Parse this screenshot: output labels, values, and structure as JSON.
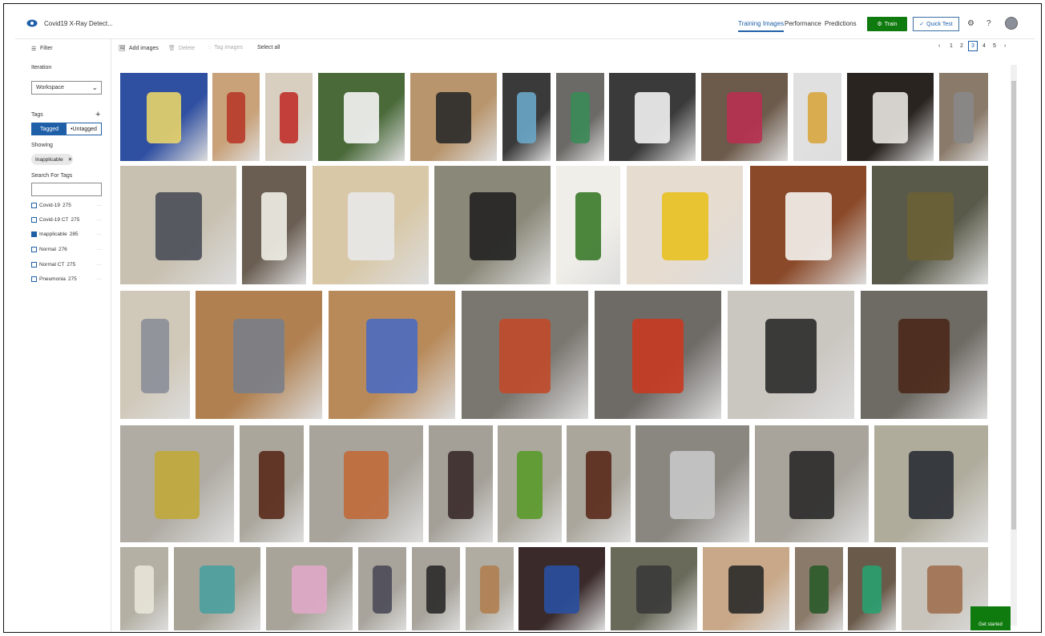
{
  "app": {
    "title": "Covid19 X-Ray Detect..."
  },
  "nav": {
    "training": "Training Images",
    "performance": "Performance",
    "predictions": "Predictions"
  },
  "buttons": {
    "train": "Train",
    "quick_test": "Quick Test"
  },
  "sidebar": {
    "filter": "Filter",
    "iteration_label": "Iteration",
    "iteration_value": "Workspace",
    "tags_label": "Tags",
    "tagged": "Tagged",
    "untagged": "Untagged",
    "showing": "Showing",
    "chip": "Inapplicable",
    "search_label": "Search For Tags",
    "tags": [
      {
        "name": "Covid-19",
        "count": "275",
        "checked": false
      },
      {
        "name": "Covid-19 CT",
        "count": "275",
        "checked": false
      },
      {
        "name": "Inapplicable",
        "count": "285",
        "checked": true
      },
      {
        "name": "Normal",
        "count": "276",
        "checked": false
      },
      {
        "name": "Normal CT",
        "count": "275",
        "checked": false
      },
      {
        "name": "Pneumonia",
        "count": "275",
        "checked": false
      }
    ]
  },
  "toolbar": {
    "add": "Add images",
    "delete": "Delete",
    "tag": "Tag images",
    "select_all": "Select all"
  },
  "pagination": {
    "pages": [
      "1",
      "2",
      "3",
      "4",
      "5"
    ],
    "current": "3"
  },
  "footer": {
    "get_started": "Get started"
  },
  "icons": [
    "eye-icon",
    "filter-icon",
    "add-icon",
    "chevron-down-icon",
    "close-icon",
    "train-icon",
    "check-icon",
    "gear-icon",
    "help-icon",
    "avatar-icon",
    "add-images-icon",
    "delete-icon",
    "tag-icon",
    "chevron-left-icon",
    "chevron-right-icon"
  ],
  "accent": "#1f5fa8",
  "train_color": "#0f7b0f"
}
